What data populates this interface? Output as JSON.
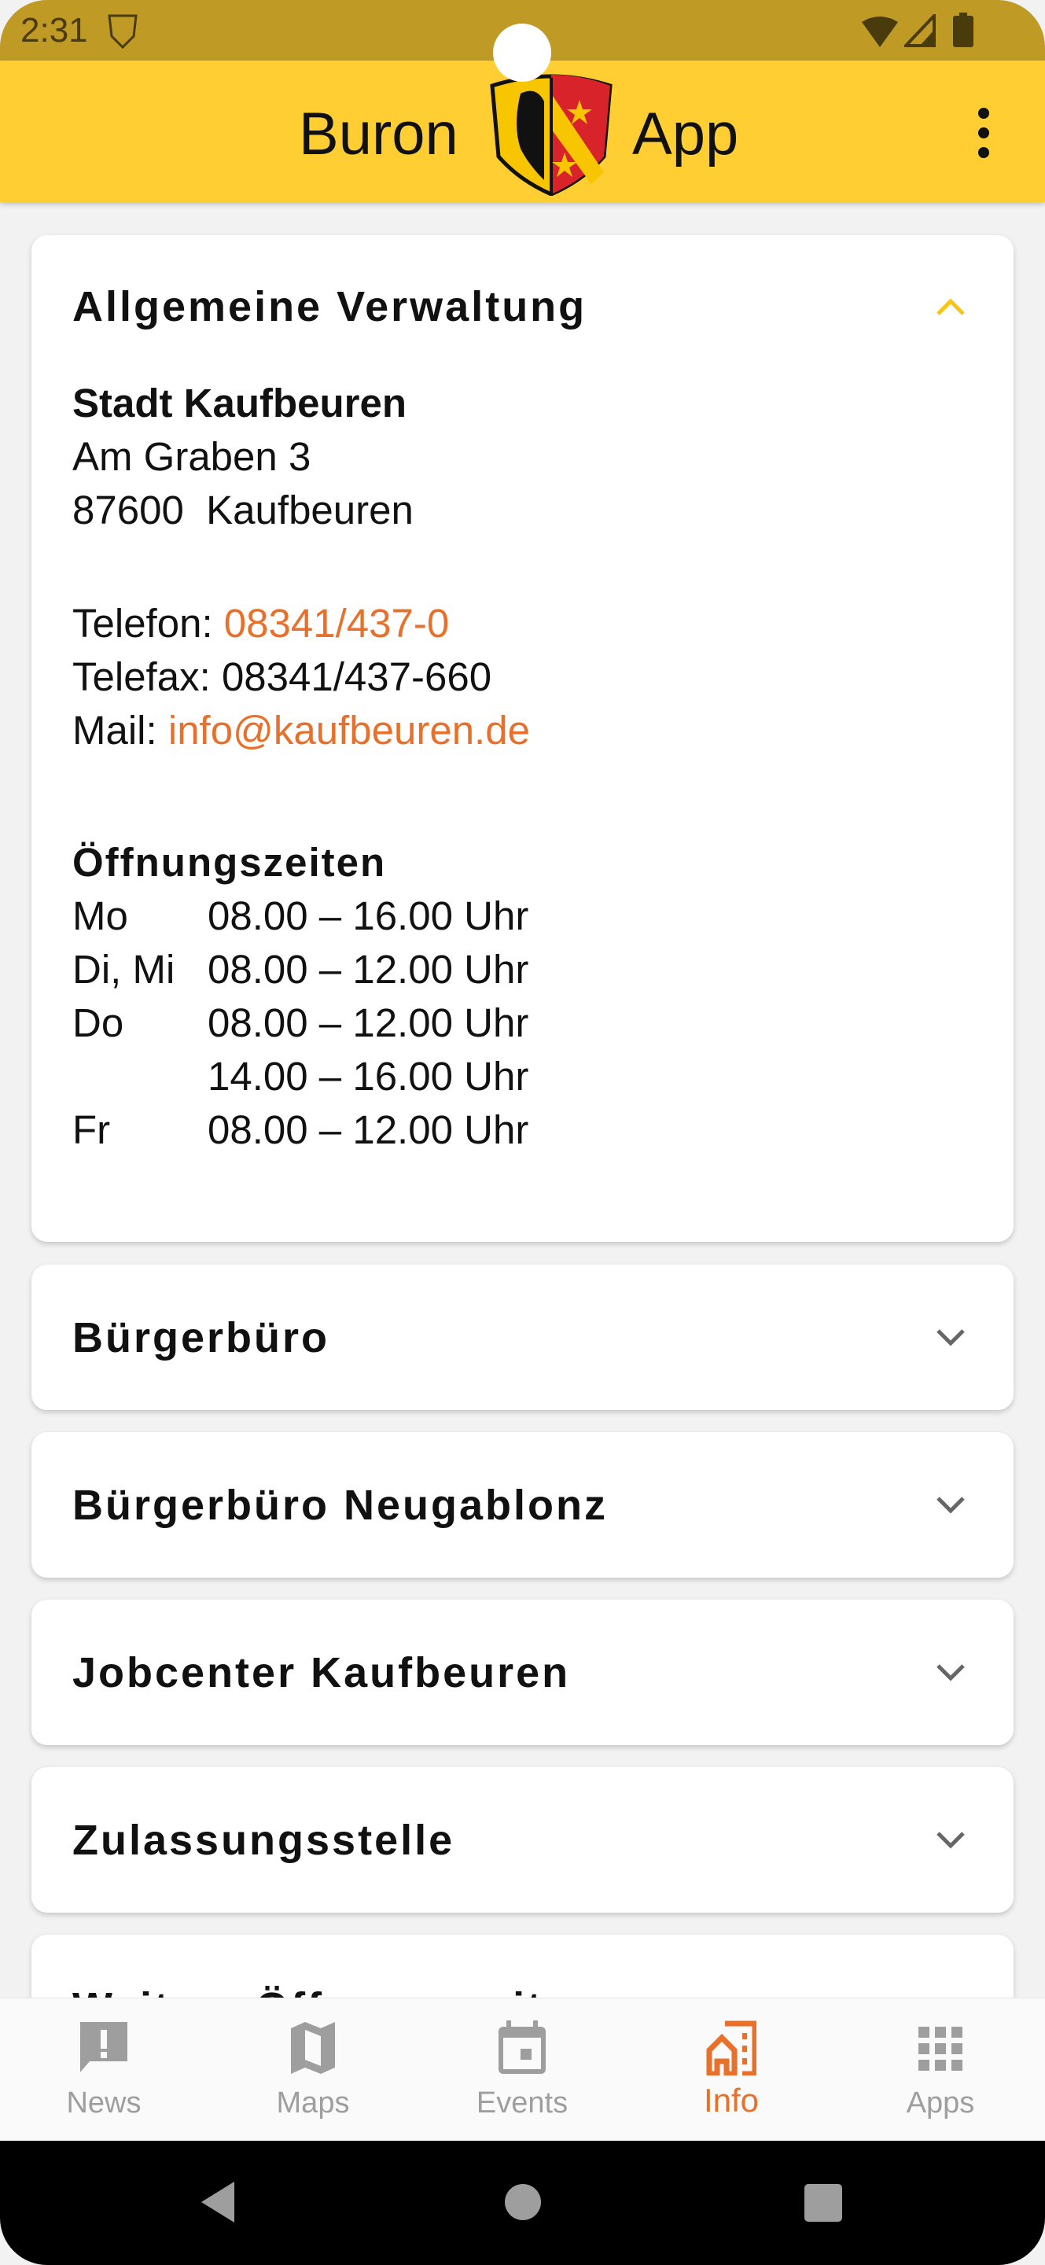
{
  "status_bar": {
    "time": "2:31",
    "icons": [
      "app-crest-icon",
      "wifi-icon",
      "signal-icon",
      "battery-icon"
    ]
  },
  "app_bar": {
    "title_left": "Buron",
    "title_right": "App",
    "logo": "kaufbeuren-coat-of-arms",
    "menu_icon": "more-vert-icon"
  },
  "sections": [
    {
      "title": "Allgemeine Verwaltung",
      "expanded": true,
      "org": "Stadt Kaufbeuren",
      "street": "Am Graben 3",
      "city": "87600  Kaufbeuren",
      "phone_label": "Telefon:",
      "phone": "08341/437-0",
      "fax_label": "Telefax:",
      "fax": "08341/437-660",
      "mail_label": "Mail:",
      "mail": "info@kaufbeuren.de",
      "hours_title": "Öffnungszeiten",
      "hours": [
        {
          "day": "Mo",
          "time": "08.00 – 16.00 Uhr"
        },
        {
          "day": "Di, Mi",
          "time": "08.00 – 12.00 Uhr"
        },
        {
          "day": "Do",
          "time": "08.00 – 12.00 Uhr"
        },
        {
          "day": "",
          "time": "14.00 – 16.00 Uhr"
        },
        {
          "day": "Fr",
          "time": "08.00 – 12.00 Uhr"
        }
      ]
    },
    {
      "title": "Bürgerbüro",
      "expanded": false
    },
    {
      "title": "Bürgerbüro Neugablonz",
      "expanded": false
    },
    {
      "title": "Jobcenter Kaufbeuren",
      "expanded": false
    },
    {
      "title": "Zulassungsstelle",
      "expanded": false
    },
    {
      "title": "Weitere Öffnungszeiten",
      "expanded": false
    }
  ],
  "bottom_nav": {
    "active": "Info",
    "items": [
      {
        "label": "News",
        "icon": "announcement-icon"
      },
      {
        "label": "Maps",
        "icon": "map-icon"
      },
      {
        "label": "Events",
        "icon": "calendar-icon"
      },
      {
        "label": "Info",
        "icon": "city-icon"
      },
      {
        "label": "Apps",
        "icon": "apps-grid-icon"
      }
    ]
  },
  "colors": {
    "accent": "#e8702a",
    "app_bar": "#ffce33",
    "status_bar": "#bf9b26",
    "chevron_active": "#f5c518"
  }
}
